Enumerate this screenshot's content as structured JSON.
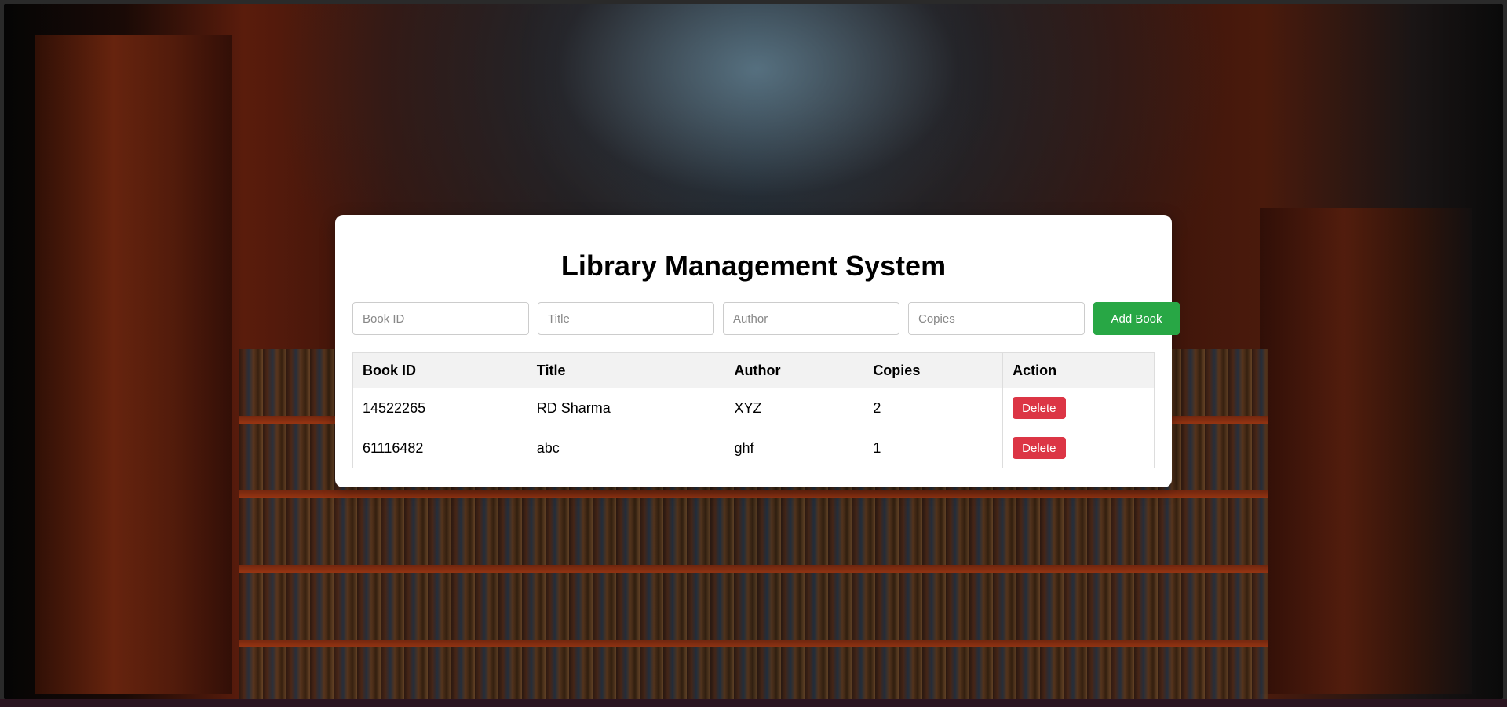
{
  "app": {
    "title": "Library Management System"
  },
  "form": {
    "book_id_placeholder": "Book ID",
    "title_placeholder": "Title",
    "author_placeholder": "Author",
    "copies_placeholder": "Copies",
    "add_button_label": "Add Book"
  },
  "table": {
    "headers": [
      "Book ID",
      "Title",
      "Author",
      "Copies",
      "Action"
    ],
    "rows": [
      {
        "book_id": "14522265",
        "title": "RD Sharma",
        "author": "XYZ",
        "copies": "2",
        "action_label": "Delete"
      },
      {
        "book_id": "61116482",
        "title": "abc",
        "author": "ghf",
        "copies": "1",
        "action_label": "Delete"
      }
    ]
  },
  "colors": {
    "add_button": "#28a745",
    "delete_button": "#dc3545",
    "card_background": "#ffffff",
    "header_background": "#f2f2f2"
  }
}
